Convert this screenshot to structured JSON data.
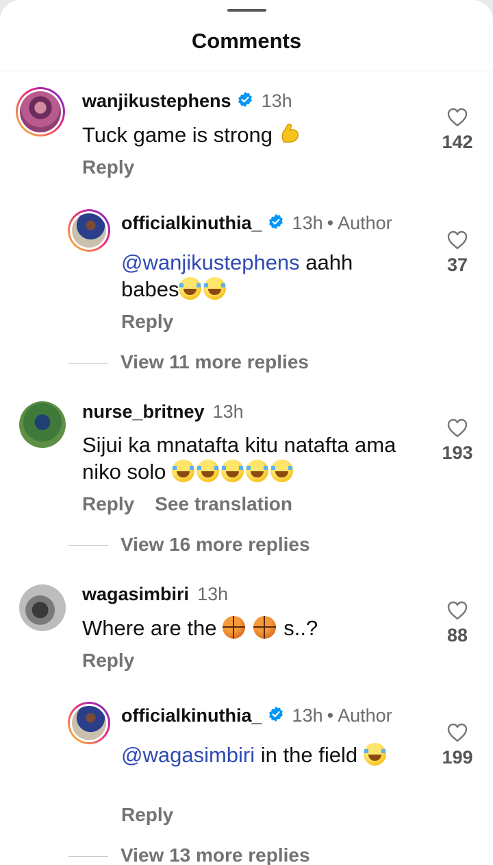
{
  "header": {
    "title": "Comments"
  },
  "comments": [
    {
      "username": "wanjikustephens",
      "verified": true,
      "time": "13h",
      "text": "Tuck game is strong",
      "likes": "142",
      "reply_label": "Reply"
    },
    {
      "username": "officialkinuthia_",
      "verified": true,
      "time": "13h",
      "author_label": "Author",
      "mention": "@wanjikustephens",
      "text": " aahh babes",
      "likes": "37",
      "reply_label": "Reply",
      "view_more": "View 11 more replies"
    },
    {
      "username": "nurse_britney",
      "verified": false,
      "time": "13h",
      "text": "Sijui ka mnatafta kitu natafta ama niko solo ",
      "likes": "193",
      "reply_label": "Reply",
      "translate_label": "See translation",
      "view_more": "View 16 more replies"
    },
    {
      "username": "wagasimbiri",
      "verified": false,
      "time": "13h",
      "text_before": "Where are the ",
      "text_after": " s..?",
      "likes": "88",
      "reply_label": "Reply"
    },
    {
      "username": "officialkinuthia_",
      "verified": true,
      "time": "13h",
      "author_label": "Author",
      "mention": "@wagasimbiri",
      "text": " in the field ",
      "likes": "199",
      "reply_label": "Reply",
      "view_more": "View 13 more replies"
    }
  ],
  "icons": {
    "like": "heart-outline-icon",
    "verified": "verified-badge-icon"
  },
  "colors": {
    "mention": "#2f4ab5",
    "verified": "#0095f6",
    "secondary_text": "#737373"
  }
}
